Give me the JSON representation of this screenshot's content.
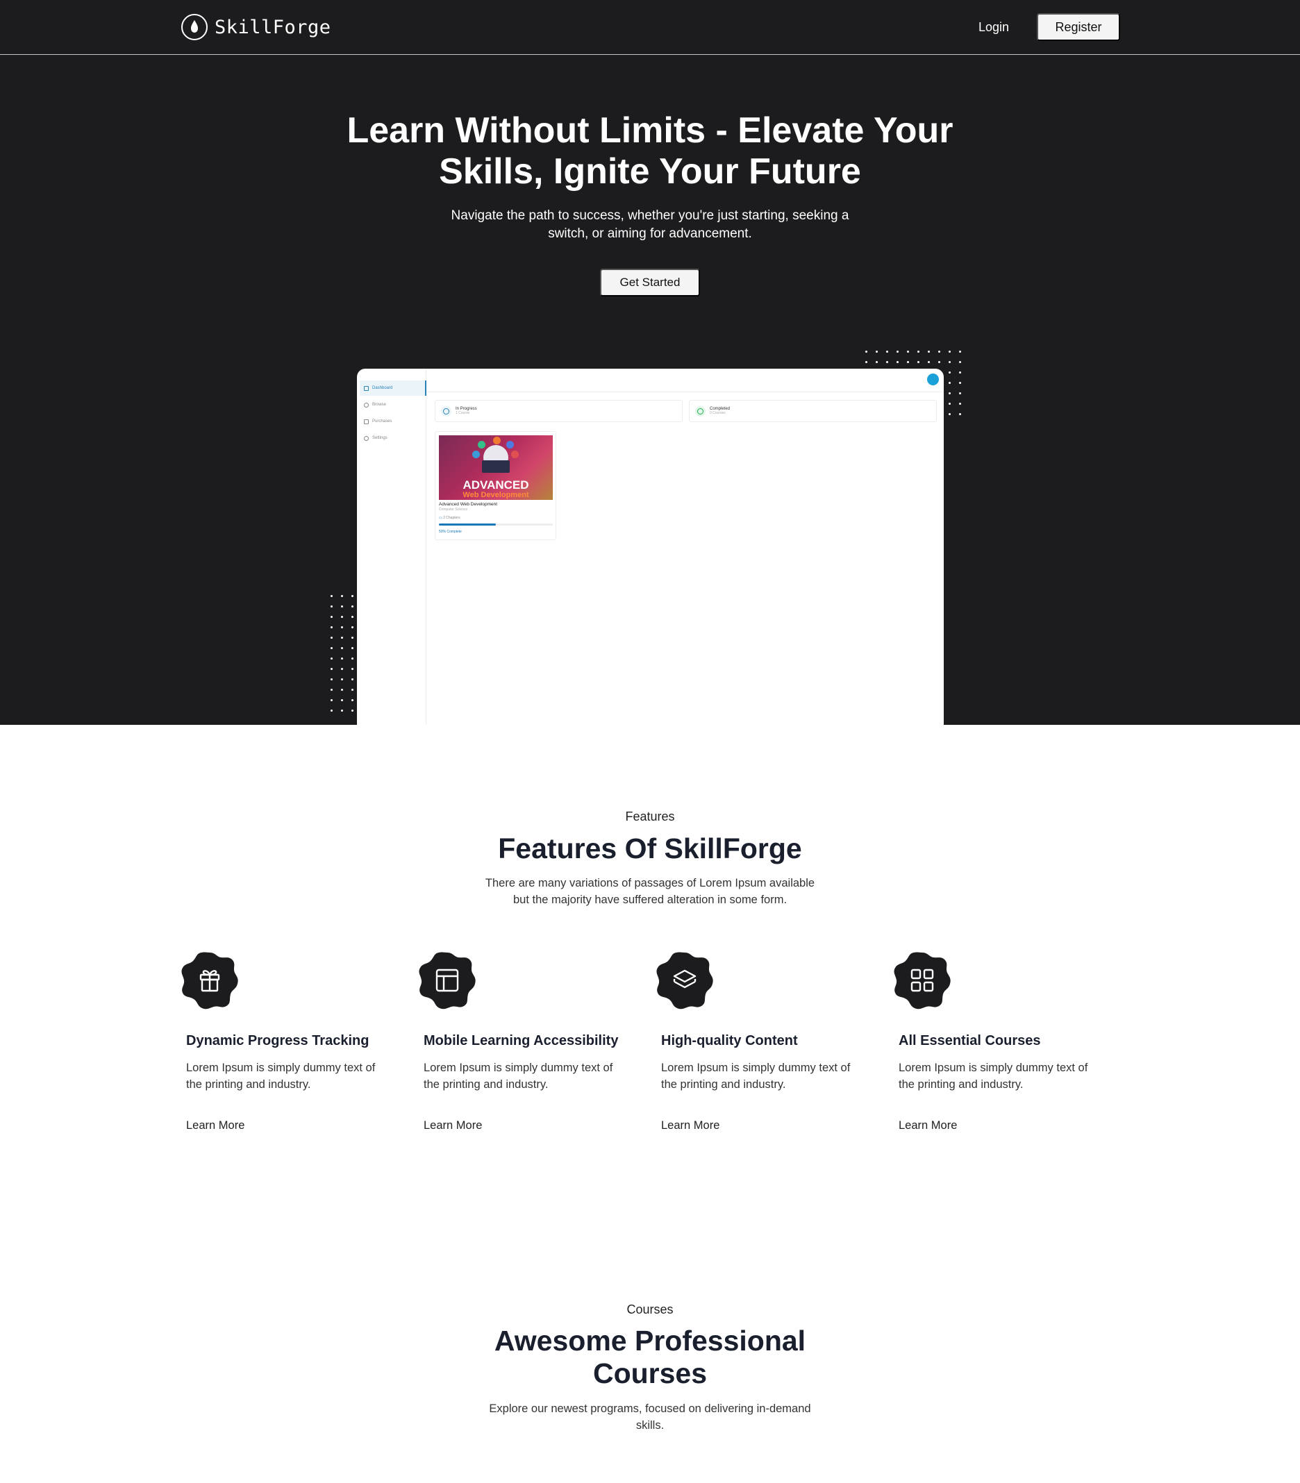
{
  "header": {
    "brand": "SkillForge",
    "login_label": "Login",
    "register_label": "Register"
  },
  "hero": {
    "title": "Learn Without Limits - Elevate Your Skills, Ignite Your Future",
    "subtitle": "Navigate the path to success, whether you're just starting, seeking a switch, or aiming for advancement.",
    "cta_label": "Get Started"
  },
  "dashboard_preview": {
    "sidebar": [
      {
        "label": "Dashboard",
        "icon": "dashboard-icon"
      },
      {
        "label": "Browse",
        "icon": "compass-icon"
      },
      {
        "label": "Purchases",
        "icon": "card-icon"
      },
      {
        "label": "Settings",
        "icon": "gear-icon"
      }
    ],
    "stats": [
      {
        "label": "In Progress",
        "count": "1 Course",
        "icon": "clock-icon"
      },
      {
        "label": "Completed",
        "count": "0 Courses",
        "icon": "check-circle-icon"
      }
    ],
    "course": {
      "thumb_title": "ADVANCED",
      "thumb_subtitle": "Web Development",
      "title": "Advanced Web Development",
      "category": "Computer Science",
      "chapters": "2 Chapters",
      "progress_percent": 50,
      "progress_label": "50% Complete"
    },
    "colors": {
      "accent": "#1b78b8",
      "avatar": "#1ba1d8",
      "completed": "#22b14c"
    }
  },
  "features": {
    "eyebrow": "Features",
    "title": "Features Of SkillForge",
    "description": "There are many variations of passages of Lorem Ipsum available but the majority have suffered alteration in some form.",
    "items": [
      {
        "icon": "gift-icon",
        "title": "Dynamic Progress Tracking",
        "description": "Lorem Ipsum is simply dummy text of the printing and industry.",
        "link": "Learn More"
      },
      {
        "icon": "layout-icon",
        "title": "Mobile Learning Accessibility",
        "description": "Lorem Ipsum is simply dummy text of the printing and industry.",
        "link": "Learn More"
      },
      {
        "icon": "layers-icon",
        "title": "High-quality Content",
        "description": "Lorem Ipsum is simply dummy text of the printing and industry.",
        "link": "Learn More"
      },
      {
        "icon": "grid-icon",
        "title": "All Essential Courses",
        "description": "Lorem Ipsum is simply dummy text of the printing and industry.",
        "link": "Learn More"
      }
    ]
  },
  "courses": {
    "eyebrow": "Courses",
    "title": "Awesome Professional Courses",
    "description": "Explore our newest programs, focused on delivering in-demand skills."
  },
  "colors": {
    "dark": "#1c1b1d",
    "heading": "#1a1f2e",
    "light_button": "#f4f4f4"
  }
}
